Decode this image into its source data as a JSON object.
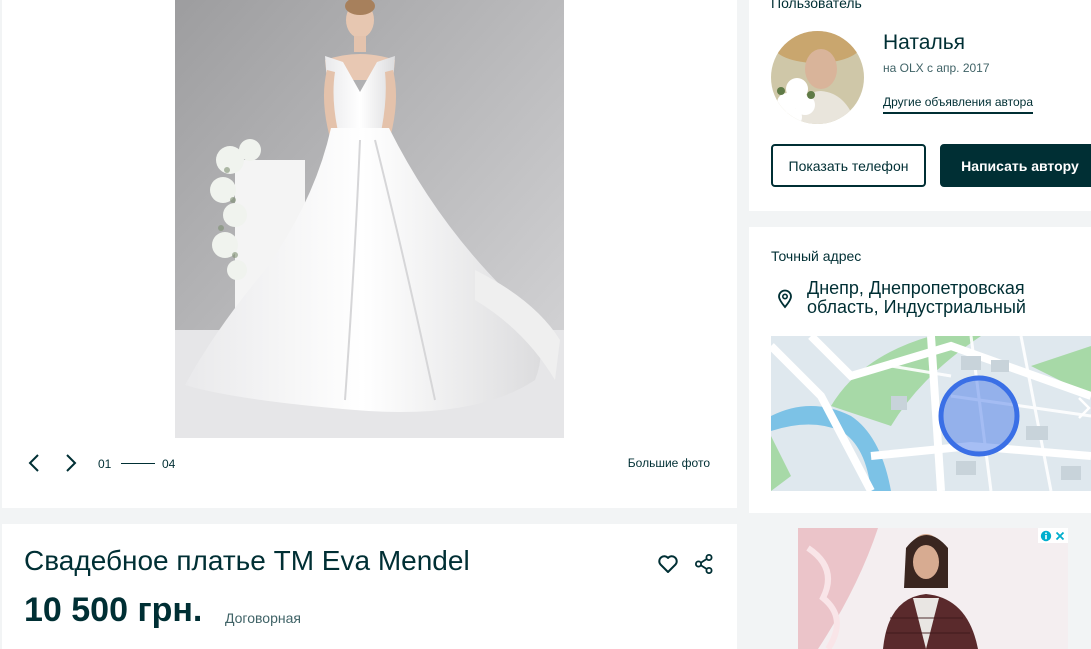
{
  "gallery": {
    "current_index": "01",
    "total_count": "04",
    "big_photos_label": "Большие фото"
  },
  "listing": {
    "title": "Свадебное платье ТМ Eva Mendel",
    "price": "10 500 грн.",
    "negotiable": "Договорная"
  },
  "seller": {
    "section_label": "Пользователь",
    "name": "Наталья",
    "since": "на OLX с апр. 2017",
    "other_ads_link": "Другие объявления автора",
    "show_phone_button": "Показать телефон",
    "write_button": "Написать автору"
  },
  "address": {
    "section_label": "Точный адрес",
    "text": "Днепр, Днепропетровская область, Индустриальный"
  },
  "colors": {
    "brand_dark": "#002f34",
    "map_circle": "#3a6fe6",
    "background": "#f2f4f5"
  },
  "icons": {
    "prev": "chevron-left-icon",
    "next": "chevron-right-icon",
    "favorite": "heart-icon",
    "share": "share-icon",
    "location": "location-pin-icon",
    "ad_info": "info-icon",
    "ad_close": "close-icon"
  }
}
